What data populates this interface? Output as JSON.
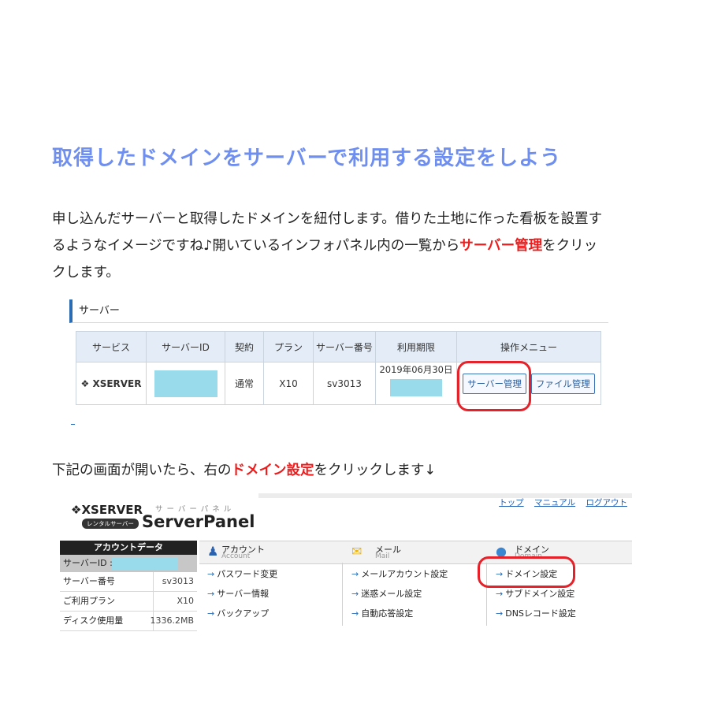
{
  "heading": "取得したドメインをサーバーで利用する設定をしよう",
  "intro": {
    "line1": "申し込んだサーバーと取得したドメインを紐付します。借りた土地に作った看板を設置す",
    "line2_pre": "るようなイメージですね♪開いているインフォパネル内の一覧から",
    "line2_red": "サーバー管理",
    "line2_post": "をクリッ",
    "line3": "クします。"
  },
  "server_box": {
    "title": "サーバー",
    "headers": [
      "サービス",
      "サーバーID",
      "契約",
      "プラン",
      "サーバー番号",
      "利用期限",
      "操作メニュー"
    ],
    "row": {
      "service": "XSERVER",
      "contract": "通常",
      "plan": "X10",
      "server_no": "sv3013",
      "expiry": "2019年06月30日",
      "btn_server": "サーバー管理",
      "btn_file": "ファイル管理"
    }
  },
  "instruction2": {
    "pre": "下記の画面が開いたら、右の",
    "red": "ドメイン設定",
    "post": "をクリックします↓"
  },
  "panel": {
    "top_links": [
      "トップ",
      "マニュアル",
      "ログアウト"
    ],
    "logo": "XSERVER",
    "logo_badge": "レンタルサーバー",
    "kana": "サーバーパネル",
    "title": "ServerPanel",
    "account": {
      "header": "アカウントデータ",
      "id_label": "サーバーID :",
      "rows": [
        {
          "key": "サーバー番号",
          "val": "sv3013"
        },
        {
          "key": "ご利用プラン",
          "val": "X10"
        },
        {
          "key": "ディスク使用量",
          "val": "1336.2MB"
        }
      ]
    },
    "columns": [
      {
        "label": "アカウント",
        "sub": "Account",
        "icon": "person-icon",
        "items": [
          "パスワード変更",
          "サーバー情報",
          "バックアップ"
        ]
      },
      {
        "label": "メール",
        "sub": "Mail",
        "icon": "mail-icon",
        "items": [
          "メールアカウント設定",
          "迷惑メール設定",
          "自動応答設定"
        ]
      },
      {
        "label": "ドメイン",
        "sub": "Domain",
        "icon": "globe-icon",
        "items": [
          "ドメイン設定",
          "サブドメイン設定",
          "DNSレコード設定"
        ]
      }
    ]
  },
  "colors": {
    "heading": "#6f8ff0",
    "emphasis": "#ee1c1c",
    "highlight_circle": "#e5222a",
    "accent_bar": "#2b6cb3"
  }
}
